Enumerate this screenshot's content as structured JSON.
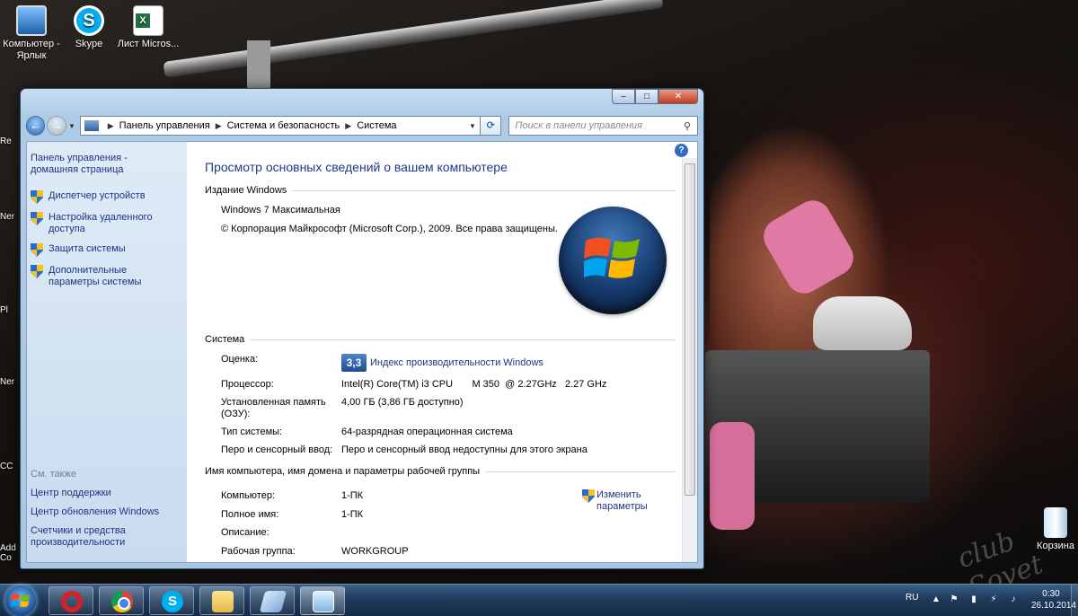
{
  "desktop": {
    "icons": [
      {
        "label": "Компьютер - Ярлык",
        "icon": "computer-shortcut-icon"
      },
      {
        "label": "Skype",
        "icon": "skype-icon"
      },
      {
        "label": "Лист Micros...",
        "icon": "excel-sheet-icon"
      }
    ],
    "recycle_bin_label": "Корзина",
    "left_stubs": [
      "Re",
      "Ner",
      "Pl",
      "Ner",
      "CC",
      "Add Co"
    ],
    "watermark_text": "club Sovet"
  },
  "window": {
    "caption_buttons": {
      "minimize": "‒",
      "maximize": "□",
      "close": "✕"
    },
    "breadcrumb": [
      "Панель управления",
      "Система и безопасность",
      "Система"
    ],
    "search_placeholder": "Поиск в панели управления",
    "sidebar": {
      "home_link": "Панель управления - домашняя страница",
      "tasks": [
        "Диспетчер устройств",
        "Настройка удаленного доступа",
        "Защита системы",
        "Дополнительные параметры системы"
      ],
      "see_also_title": "См. также",
      "see_also_links": [
        "Центр поддержки",
        "Центр обновления Windows",
        "Счетчики и средства производительности"
      ]
    },
    "main": {
      "page_title": "Просмотр основных сведений о вашем компьютере",
      "edition_header": "Издание Windows",
      "edition_name": "Windows 7 Максимальная",
      "copyright": "© Корпорация Майкрософт (Microsoft Corp.), 2009. Все права защищены.",
      "system_header": "Система",
      "rating_label": "Оценка:",
      "rating_score": "3,3",
      "rating_link": "Индекс производительности Windows",
      "cpu_label": "Процессор:",
      "cpu_value": "Intel(R) Core(TM) i3 CPU       M 350  @ 2.27GHz   2.27 GHz",
      "ram_label": "Установленная память (ОЗУ):",
      "ram_value": "4,00 ГБ (3,86 ГБ доступно)",
      "type_label": "Тип системы:",
      "type_value": "64-разрядная операционная система",
      "pen_label": "Перо и сенсорный ввод:",
      "pen_value": "Перо и сенсорный ввод недоступны для этого экрана",
      "name_header": "Имя компьютера, имя домена и параметры рабочей группы",
      "computer_label": "Компьютер:",
      "computer_value": "1-ПК",
      "fullname_label": "Полное имя:",
      "fullname_value": "1-ПК",
      "desc_label": "Описание:",
      "desc_value": "",
      "workgroup_label": "Рабочая группа:",
      "workgroup_value": "WORKGROUP",
      "change_link": "Изменить параметры"
    }
  },
  "taskbar": {
    "apps": [
      "opera",
      "chrome",
      "skype",
      "explorer",
      "aero",
      "control-panel"
    ],
    "language": "RU",
    "time": "0:30",
    "date": "26.10.2014"
  }
}
